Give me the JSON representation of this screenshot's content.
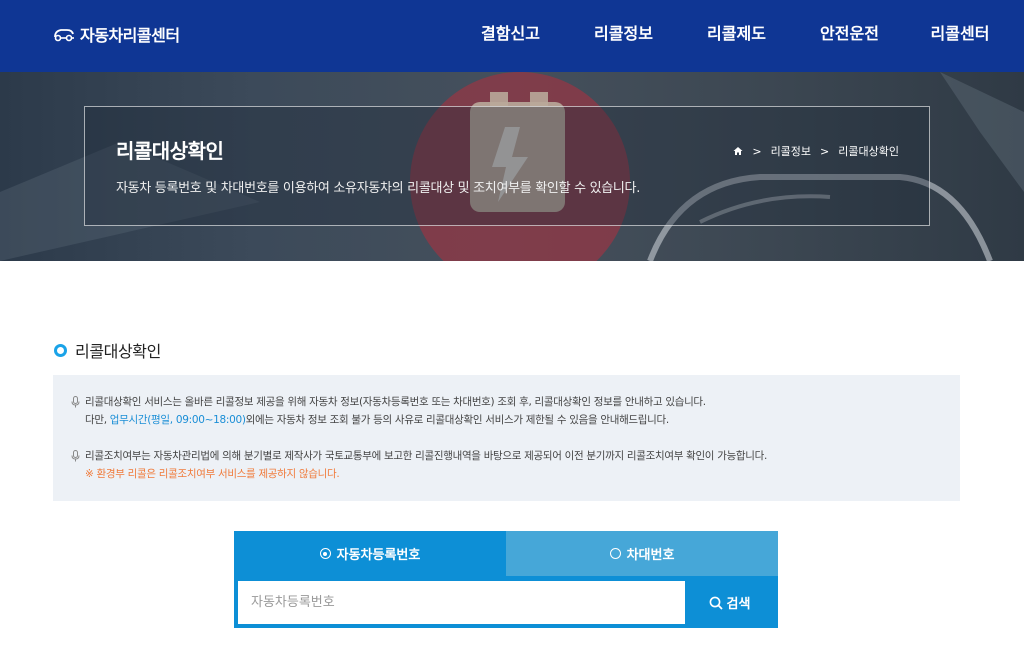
{
  "header": {
    "logo_text": "자동차리콜센터",
    "nav": [
      "결함신고",
      "리콜정보",
      "리콜제도",
      "안전운전",
      "리콜센터"
    ]
  },
  "hero": {
    "title": "리콜대상확인",
    "description": "자동차 등록번호 및 차대번호를 이용하여 소유자동차의 리콜대상 및 조치여부를 확인할 수 있습니다.",
    "breadcrumb": [
      "리콜정보",
      "리콜대상확인"
    ]
  },
  "section": {
    "title": "리콜대상확인"
  },
  "info": {
    "line1": "리콜대상확인 서비스는 올바른 리콜정보 제공을 위해 자동차 정보(자동차등록번호 또는 차대번호) 조회 후, 리콜대상확인 정보를 안내하고 있습니다.",
    "line2_prefix": "다만, ",
    "line2_highlight": "업무시간(평일, 09:00~18:00)",
    "line2_suffix": "외에는 자동차 정보 조회 불가 등의 사유로 리콜대상확인 서비스가 제한될 수 있음을 안내해드립니다.",
    "line3": "리콜조치여부는 자동차관리법에 의해 분기별로 제작사가 국토교통부에 보고한 리콜진행내역을 바탕으로 제공되어 이전 분기까지 리콜조치여부 확인이 가능합니다.",
    "line4": "※ 환경부 리콜은 리콜조치여부 서비스를 제공하지 않습니다."
  },
  "search": {
    "tabs": [
      {
        "label": "자동차등록번호",
        "selected": true
      },
      {
        "label": "차대번호",
        "selected": false
      }
    ],
    "placeholder": "자동차등록번호",
    "value": "",
    "button_label": "검색"
  },
  "colors": {
    "header_bg": "#0f3694",
    "accent": "#0d8fd6",
    "tab_inactive": "#46a7d8",
    "info_bg": "#edf1f6",
    "highlight_blue": "#1a8ed6",
    "highlight_orange": "#f07b3b"
  }
}
